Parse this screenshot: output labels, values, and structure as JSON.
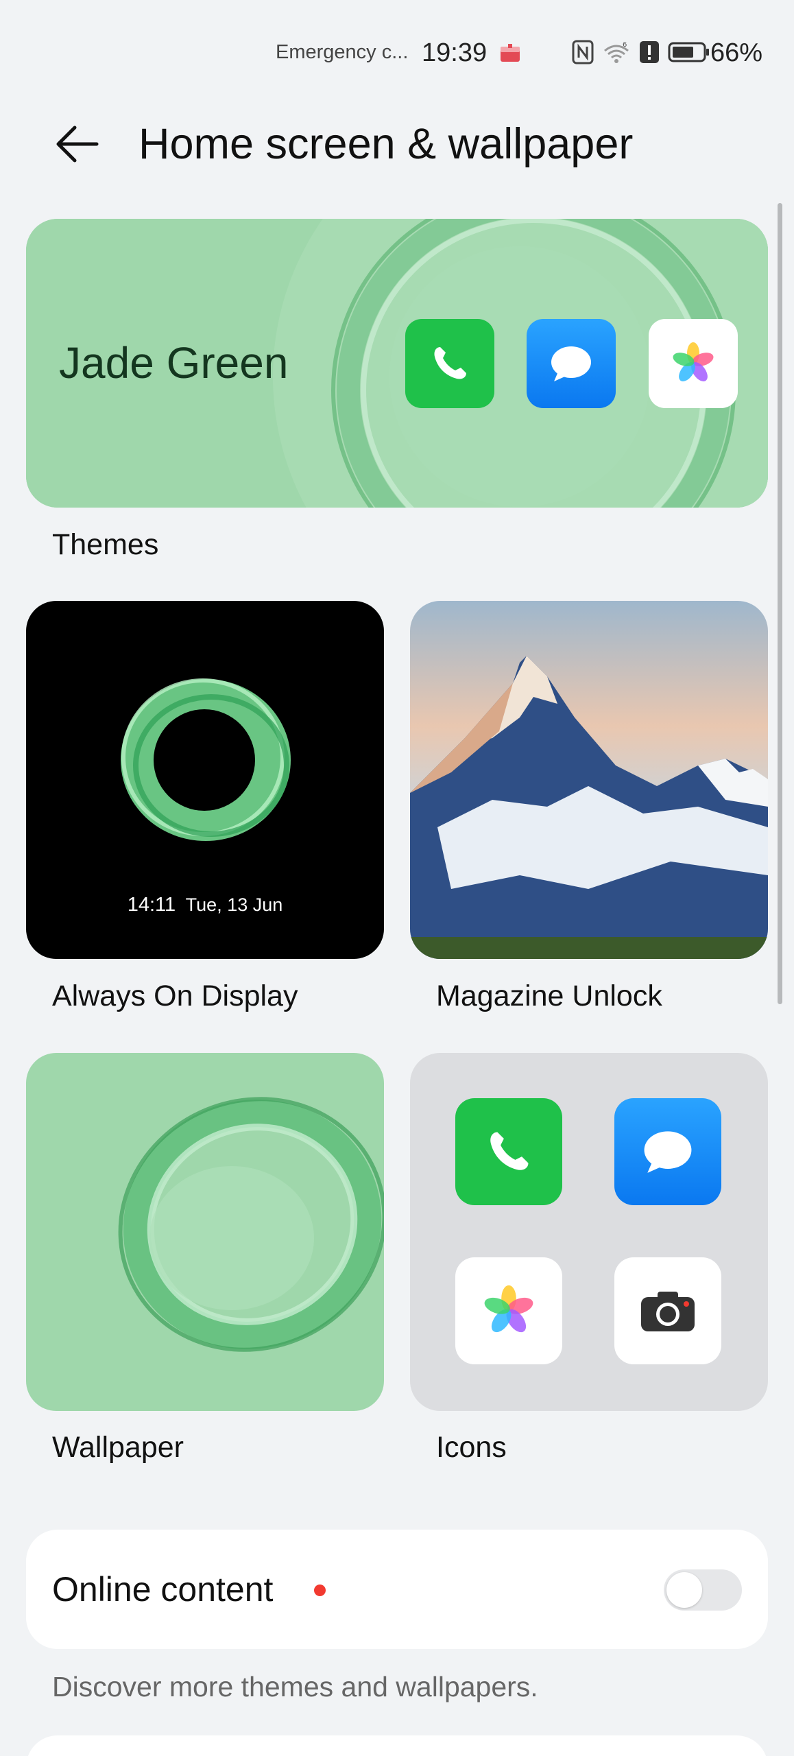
{
  "status_bar": {
    "carrier_text": "Emergency c...",
    "time": "19:39",
    "battery_percent": "66%",
    "icons": [
      "notification-icon",
      "nfc-icon",
      "wifi-icon",
      "alert-icon",
      "battery-icon"
    ]
  },
  "header": {
    "back_icon": "back-arrow-icon",
    "title": "Home screen & wallpaper"
  },
  "themes": {
    "current_theme": "Jade Green",
    "label": "Themes",
    "preview_apps": [
      "phone-icon",
      "messages-icon",
      "gallery-icon"
    ]
  },
  "tiles": {
    "always_on_display": {
      "label": "Always On Display",
      "preview_time": "14:11",
      "preview_date": "Tue, 13 Jun"
    },
    "magazine_unlock": {
      "label": "Magazine Unlock"
    },
    "wallpaper": {
      "label": "Wallpaper"
    },
    "icons": {
      "label": "Icons",
      "apps": [
        "phone-icon",
        "messages-icon",
        "gallery-icon",
        "camera-icon"
      ]
    }
  },
  "online_content": {
    "label": "Online content",
    "toggle_on": false,
    "description": "Discover more themes and wallpapers."
  },
  "colors": {
    "background": "#f1f3f5",
    "theme_green": "#9fd7ab",
    "phone_green": "#1fc14a",
    "messages_blue": "#1a8cff",
    "notification_dot": "#f23a30"
  }
}
